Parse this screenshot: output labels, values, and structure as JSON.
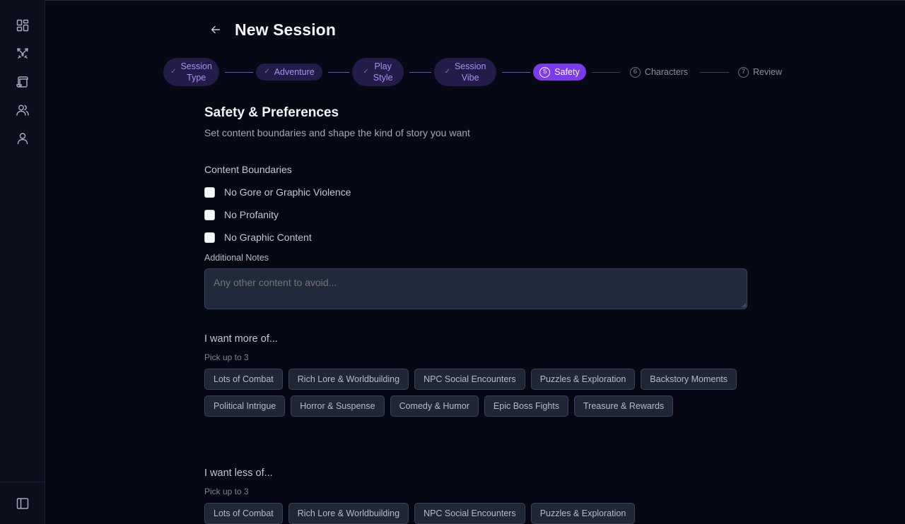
{
  "page": {
    "title": "New Session"
  },
  "stepper": {
    "steps": [
      {
        "line1": "Session",
        "line2": "Type",
        "state": "done"
      },
      {
        "line1": "Adventure",
        "line2": "",
        "state": "done"
      },
      {
        "line1": "Play",
        "line2": "Style",
        "state": "done"
      },
      {
        "line1": "Session",
        "line2": "Vibe",
        "state": "done"
      },
      {
        "number": "5",
        "label": "Safety",
        "state": "active"
      },
      {
        "number": "6",
        "label": "Characters",
        "state": "future"
      },
      {
        "number": "7",
        "label": "Review",
        "state": "future"
      }
    ],
    "done_mark": "✓"
  },
  "section": {
    "title": "Safety & Preferences",
    "subtitle": "Set content boundaries and shape the kind of story you want"
  },
  "boundaries": {
    "label": "Content Boundaries",
    "options": [
      {
        "label": "No Gore or Graphic Violence",
        "checked": false
      },
      {
        "label": "No Profanity",
        "checked": false
      },
      {
        "label": "No Graphic Content",
        "checked": false
      }
    ]
  },
  "notes": {
    "label": "Additional Notes",
    "placeholder": "Any other content to avoid...",
    "value": ""
  },
  "more_of": {
    "title": "I want more of...",
    "hint": "Pick up to 3",
    "chips": [
      "Lots of Combat",
      "Rich Lore & Worldbuilding",
      "NPC Social Encounters",
      "Puzzles & Exploration",
      "Backstory Moments",
      "Political Intrigue",
      "Horror & Suspense",
      "Comedy & Humor",
      "Epic Boss Fights",
      "Treasure & Rewards"
    ]
  },
  "less_of": {
    "title": "I want less of...",
    "hint": "Pick up to 3",
    "chips": [
      "Lots of Combat",
      "Rich Lore & Worldbuilding",
      "NPC Social Encounters",
      "Puzzles & Exploration"
    ]
  },
  "sidebar": {
    "icons": [
      "dashboard-icon",
      "crossed-swords-icon",
      "scroll-icon",
      "users-icon",
      "user-icon",
      "sidebar-toggle-icon"
    ]
  },
  "colors": {
    "accent": "#7c3aed",
    "background": "#060814"
  }
}
